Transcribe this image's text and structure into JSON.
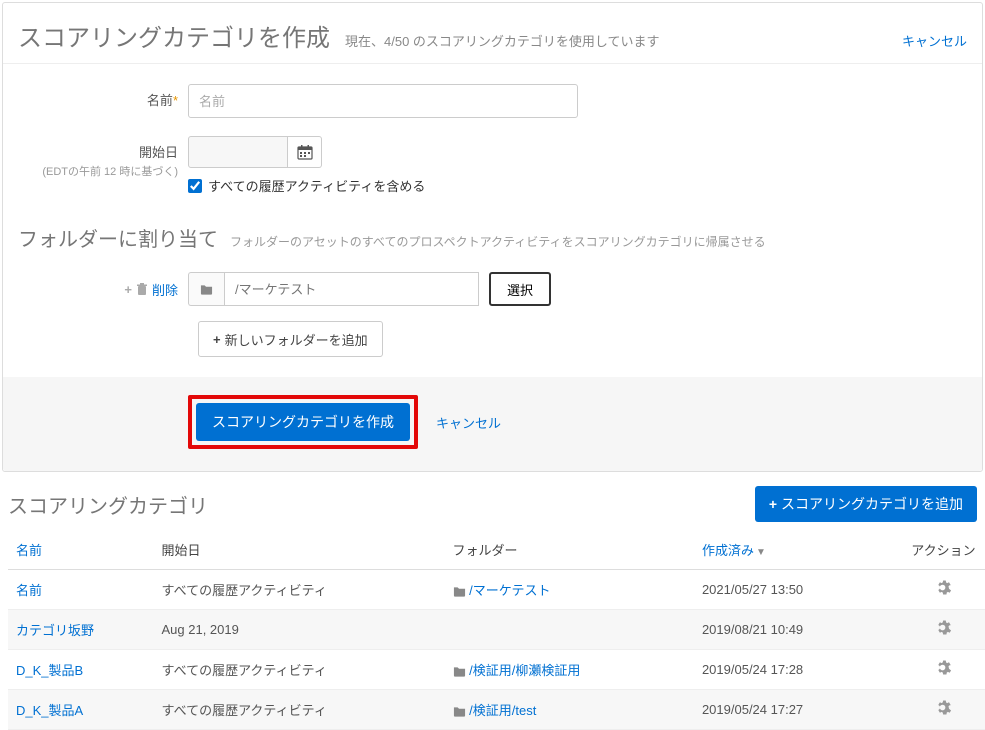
{
  "header": {
    "title": "スコアリングカテゴリを作成",
    "subtitle": "現在、4/50 のスコアリングカテゴリを使用しています",
    "cancel": "キャンセル"
  },
  "form": {
    "name_label": "名前*",
    "name_placeholder": "名前",
    "start_label": "開始日",
    "start_sublabel": "(EDTの午前 12 時に基づく)",
    "include_history": "すべての履歴アクティビティを含める"
  },
  "assign": {
    "title": "フォルダーに割り当て",
    "subtitle": "フォルダーのアセットのすべてのプロスペクトアクティビティをスコアリングカテゴリに帰属させる",
    "delete_label": "削除",
    "folder_placeholder": "/マーケテスト",
    "select_btn": "選択",
    "add_folder": "新しいフォルダーを追加"
  },
  "footer": {
    "create_btn": "スコアリングカテゴリを作成",
    "cancel": "キャンセル"
  },
  "list": {
    "title": "スコアリングカテゴリ",
    "add_btn": "スコアリングカテゴリを追加",
    "columns": {
      "name": "名前",
      "start": "開始日",
      "folder": "フォルダー",
      "created": "作成済み",
      "actions": "アクション"
    },
    "rows": [
      {
        "name": "名前",
        "start": "すべての履歴アクティビティ",
        "folder": "/マーケテスト",
        "has_folder": true,
        "created": "2021/05/27 13:50"
      },
      {
        "name": "カテゴリ坂野",
        "start": "Aug 21, 2019",
        "folder": "",
        "has_folder": false,
        "created": "2019/08/21 10:49"
      },
      {
        "name": "D_K_製品B",
        "start": "すべての履歴アクティビティ",
        "folder": "/検証用/柳瀬検証用",
        "has_folder": true,
        "created": "2019/05/24 17:28"
      },
      {
        "name": "D_K_製品A",
        "start": "すべての履歴アクティビティ",
        "folder": "/検証用/test",
        "has_folder": true,
        "created": "2019/05/24 17:27"
      }
    ]
  }
}
